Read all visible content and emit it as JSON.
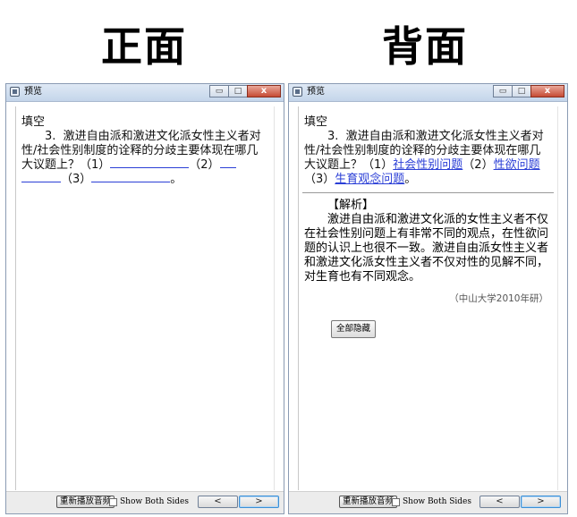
{
  "headings": {
    "front": "正面",
    "back": "背面"
  },
  "front_window": {
    "title": "预览",
    "controls": {
      "minimize": "▭",
      "maximize": "□",
      "close": "x"
    },
    "question": {
      "type": "填空",
      "number": "3.",
      "stem": "激进自由派和激进文化派女性主义者对性/社会性别制度的诠释的分歧主要体现在哪几大议题上？（1）",
      "mid2": "（2）",
      "mid3": "（3）",
      "end": "。"
    },
    "footer": {
      "replay": "重新播放音频",
      "show_both": "Show Both Sides",
      "prev": "<",
      "next": ">"
    }
  },
  "back_window": {
    "title": "预览",
    "controls": {
      "minimize": "▭",
      "maximize": "□",
      "close": "x"
    },
    "question": {
      "type": "填空",
      "number": "3.",
      "stem": "激进自由派和激进文化派女性主义者对性/社会性别制度的诠释的分歧主要体现在哪几大议题上？（1）",
      "answer1": "社会性别问题",
      "mid2": "（2）",
      "answer2": "性欲问题",
      "mid3": "（3）",
      "answer3": "生育观念问题",
      "end": "。"
    },
    "analysis": {
      "title": "【解析】",
      "body": "激进自由派和激进文化派的女性主义者不仅在社会性别问题上有非常不同的观点，在性欲问题的认识上也很不一致。激进自由派女性主义者和激进文化派女性主义者不仅对性的见解不同，对生育也有不同观念。",
      "source": "（中山大学2010年研）",
      "hide_all": "全部隐藏"
    },
    "footer": {
      "replay": "重新播放音频",
      "show_both": "Show Both Sides",
      "prev": "<",
      "next": ">"
    }
  }
}
